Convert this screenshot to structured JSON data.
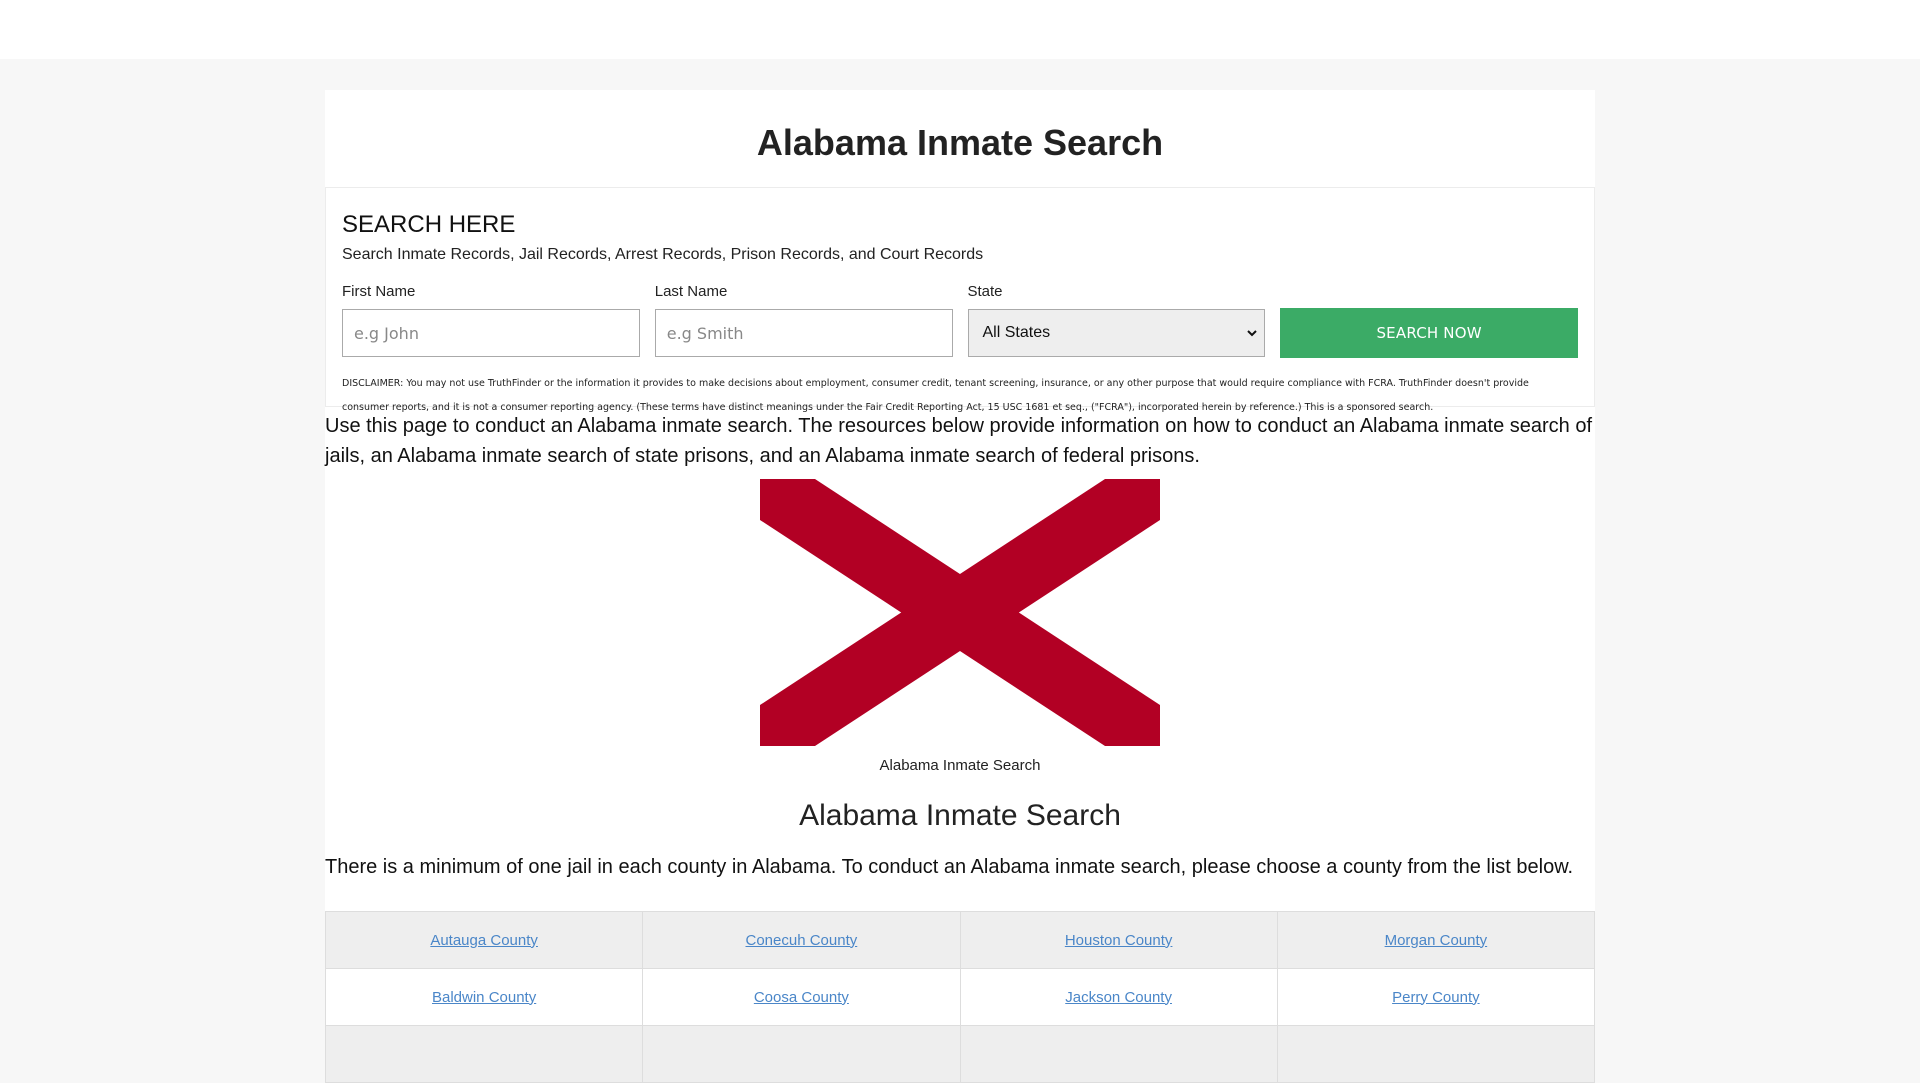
{
  "page": {
    "title": "Alabama Inmate Search"
  },
  "search": {
    "heading": "SEARCH HERE",
    "subheading": "Search Inmate Records, Jail Records, Arrest Records, Prison Records, and Court Records",
    "first_name_label": "First Name",
    "first_name_placeholder": "e.g John",
    "last_name_label": "Last Name",
    "last_name_placeholder": "e.g Smith",
    "state_label": "State",
    "state_value": "All States",
    "button_label": "SEARCH NOW",
    "button_color": "#3bab66",
    "disclaimer": "DISCLAIMER: You may not use TruthFinder or the information it provides to make decisions about employment, consumer credit, tenant screening, insurance, or any other purpose that would require compliance with FCRA. TruthFinder doesn't provide consumer reports, and it is not a consumer reporting agency. (These terms have distinct meanings under the Fair Credit Reporting Act, 15 USC 1681 et seq., (\"FCRA\"), incorporated herein by reference.) This is a sponsored search."
  },
  "content": {
    "intro": "Use this page to conduct an Alabama inmate search. The resources below provide information on how to conduct an Alabama inmate search of jails, an Alabama inmate search of state prisons, and an Alabama inmate search of federal prisons.",
    "flag_caption": "Alabama Inmate Search",
    "flag_color": "#b20024",
    "section_heading": "Alabama Inmate Search",
    "section_text": "There is a minimum of one jail in each county in Alabama. To conduct an Alabama inmate search, please choose a county from the list below."
  },
  "counties": {
    "row0": [
      "Autauga County",
      "Conecuh County",
      "Houston County",
      "Morgan County"
    ],
    "row1": [
      "Baldwin County",
      "Coosa County",
      "Jackson County",
      "Perry County"
    ]
  }
}
